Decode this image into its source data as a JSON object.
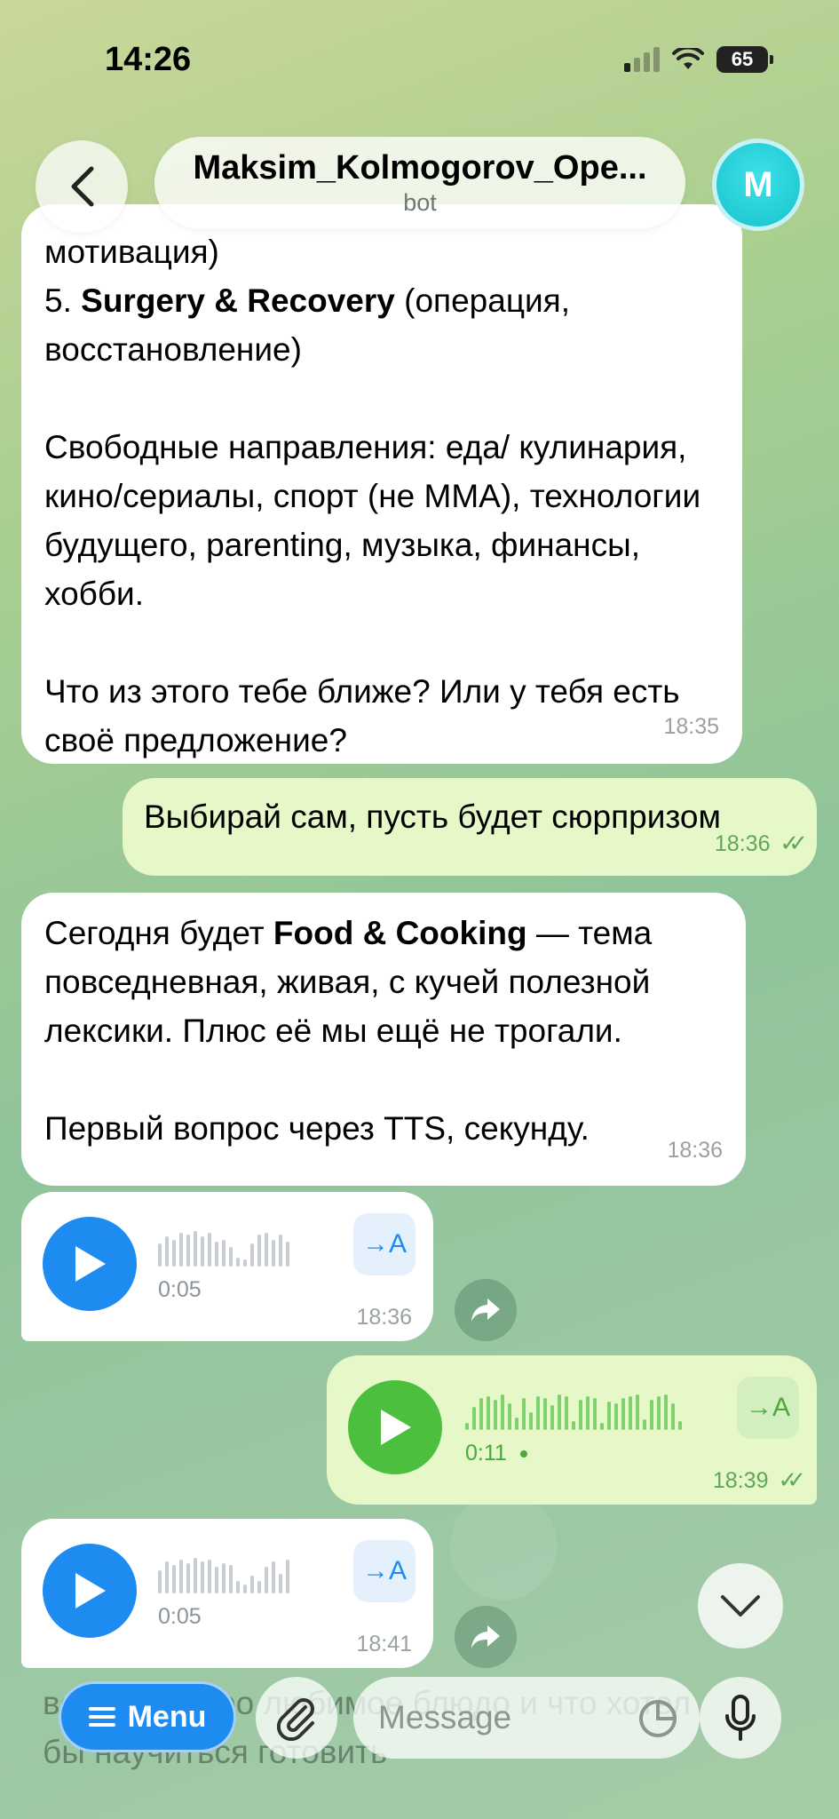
{
  "status_bar": {
    "time": "14:26",
    "battery": "65"
  },
  "header": {
    "title": "Maksim_Kolmogorov_Ope...",
    "subtitle": "bot",
    "avatar_letter": "M"
  },
  "messages": {
    "m1": {
      "line1_prefix": "мотивация)",
      "line2_num": "5. ",
      "line2_bold": "Surgery & Recovery",
      "line2_rest": " (операция,",
      "line3": "восстановление)",
      "para2": "Свободные направления: еда/ кулинария, кино/сериалы, спорт (не MMA), технологии будущего, parenting, музыка, финансы, хобби.",
      "para3": "Что из этого тебе ближе? Или у тебя есть своё предложение?",
      "time": "18:35"
    },
    "m2": {
      "text": "Выбирай сам, пусть будет сюрпризом",
      "time": "18:36"
    },
    "m3": {
      "prefix": "Сегодня будет ",
      "bold": "Food & Cooking",
      "rest": " — тема повседневная, живая, с кучей полезной лексики. Плюс её мы ещё не трогали.",
      "para2": "Первый вопрос через TTS, секунду.",
      "time": "18:36"
    },
    "voice1": {
      "duration": "0:05",
      "time": "18:36",
      "transcribe": "→A"
    },
    "voice2": {
      "duration": "0:11",
      "time": "18:39",
      "transcribe": "→A"
    },
    "voice3": {
      "duration": "0:05",
      "time": "18:41",
      "transcribe": "→A"
    }
  },
  "behind_text": "вопрос — про любимое блюдо и что хотел бы научиться готовить",
  "input_bar": {
    "menu_label": "Menu",
    "placeholder": "Message"
  },
  "colors": {
    "accent": "#1d8bf0",
    "outgoing": "#e6f7c8",
    "voice_out": "#4cc03e"
  },
  "icons": [
    "back-arrow",
    "play",
    "share-forward",
    "chevron-down",
    "paperclip",
    "sticker",
    "microphone"
  ]
}
